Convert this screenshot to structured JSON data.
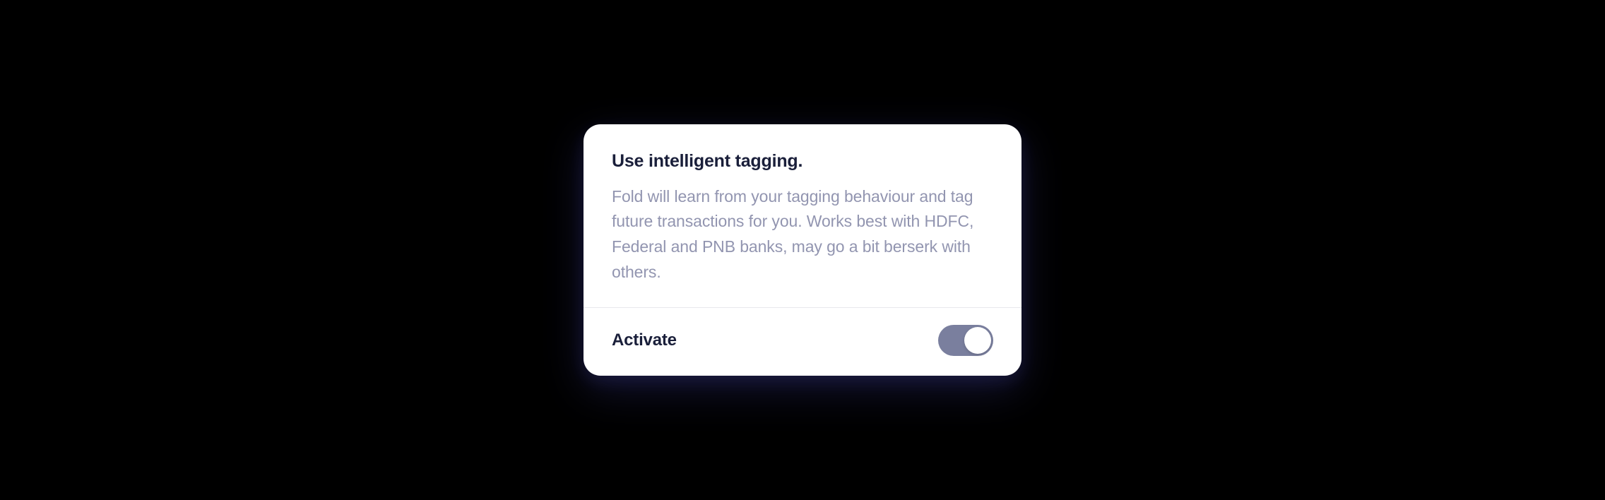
{
  "card": {
    "title": "Use intelligent tagging.",
    "description": "Fold will learn from your tagging behaviour and tag future transactions for you. Works best with HDFC, Federal and PNB banks, may go a bit berserk with others.",
    "footer_label": "Activate",
    "toggle_state": "on"
  },
  "colors": {
    "background": "#000000",
    "card_bg": "#ffffff",
    "title_text": "#1a1f3a",
    "description_text": "#9295b0",
    "divider": "#e8e8ed",
    "toggle_track": "#7a7f9e",
    "toggle_knob": "#ffffff"
  }
}
